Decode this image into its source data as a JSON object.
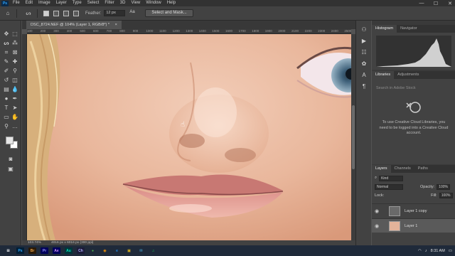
{
  "app": {
    "logo_text": "Ps"
  },
  "menu": [
    "File",
    "Edit",
    "Image",
    "Layer",
    "Type",
    "Select",
    "Filter",
    "3D",
    "View",
    "Window",
    "Help"
  ],
  "window_controls": {
    "minimize": "—",
    "maximize": "☐",
    "close": "✕"
  },
  "options_bar": {
    "feather_label": "Feather:",
    "feather_value": "12 px",
    "antialias_label": "Aa",
    "select_mask_label": "Select and Mask..."
  },
  "document": {
    "tab_title": "DSC_8724.NEF @ 104% (Layer 1, RGB/8*) *",
    "tab_close": "×"
  },
  "ruler": {
    "ticks": [
      "100",
      "150",
      "200",
      "250",
      "300",
      "350",
      "400",
      "450",
      "500",
      "550",
      "600",
      "650",
      "700",
      "750",
      "800",
      "850",
      "900",
      "950",
      "1000",
      "1050",
      "1100",
      "1150",
      "1200",
      "1250",
      "1300",
      "1350",
      "1400",
      "1450",
      "1500",
      "1550",
      "1600",
      "1650",
      "1700",
      "1750",
      "1800",
      "1850",
      "1900",
      "1950",
      "2000",
      "2050",
      "2100",
      "2150",
      "2200",
      "2250",
      "2300",
      "2350",
      "2400",
      "2450",
      "2500"
    ]
  },
  "status": {
    "zoom": "103.74%",
    "doc_info": "4016 px x 6016 px (300 ppi)"
  },
  "panels": {
    "histogram_tabs": [
      "Histogram",
      "Navigator"
    ],
    "libraries_tabs": [
      "Libraries",
      "Adjustments"
    ],
    "libraries_search_placeholder": "Search in Adobe Stock",
    "libraries_message": "To use Creative Cloud Libraries, you need to be logged into a Creative Cloud account.",
    "layers_tabs": [
      "Layers",
      "Channels",
      "Paths"
    ],
    "kind_label": "Kind",
    "blend_mode": "Normal",
    "opacity_label": "Opacity:",
    "opacity_value": "100%",
    "lock_label": "Lock:",
    "fill_label": "Fill:",
    "fill_value": "100%",
    "layers": [
      {
        "name": "Layer 1 copy",
        "selected": false
      },
      {
        "name": "Layer 1",
        "selected": true
      }
    ]
  },
  "taskbar": {
    "apps": [
      "⊞",
      "Ps",
      "Br",
      "Pr",
      "Ae",
      "Au",
      "Ch",
      "●",
      "◉",
      "e",
      "▣",
      "✉",
      "♫"
    ],
    "time": "8:31 AM"
  },
  "colors": {
    "accent": "#31a8ff",
    "canvas_skin": "#e6b49b"
  }
}
